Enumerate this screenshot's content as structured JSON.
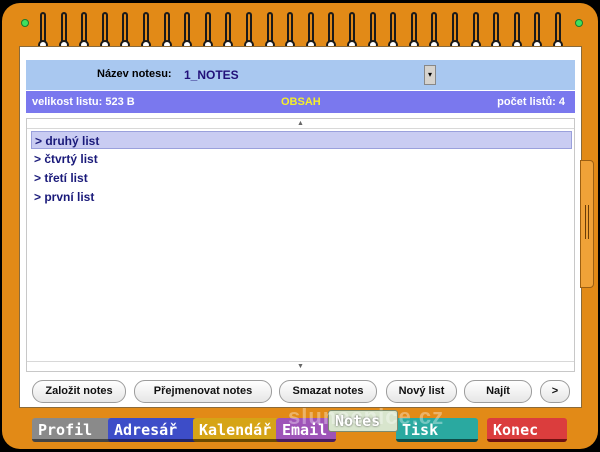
{
  "notebook": {
    "name_label": "Název notesu:",
    "name_value": "1_NOTES",
    "dropdown_glyph": "▾"
  },
  "info": {
    "size_text": "velikost listu: 523 B",
    "title": "OBSAH",
    "count_text": "počet listů: 4"
  },
  "list": {
    "scroll_up": "▲",
    "scroll_down": "▼",
    "items": [
      {
        "label": "> druhý list",
        "selected": true
      },
      {
        "label": "> čtvrtý list",
        "selected": false
      },
      {
        "label": "> třetí list",
        "selected": false
      },
      {
        "label": "> první list",
        "selected": false
      }
    ]
  },
  "buttons": {
    "create": "Založit notes",
    "rename": "Přejmenovat notes",
    "delete": "Smazat notes",
    "new_sheet": "Nový list",
    "find": "Najít",
    "next": ">"
  },
  "tabs": {
    "profil": "Profil",
    "adresar": "Adresář",
    "kalendar": "Kalendář",
    "email": "Email",
    "notes": "Notes",
    "tisk": "Tisk",
    "konec": "Konec"
  },
  "watermark": "slunecnice.cz",
  "colors": {
    "frame": "#e28a17",
    "name_bar": "#a9c8f0",
    "info_bar": "#7a78ee",
    "info_title": "#f5ef2a",
    "selected_item": "#c9ccf2"
  }
}
